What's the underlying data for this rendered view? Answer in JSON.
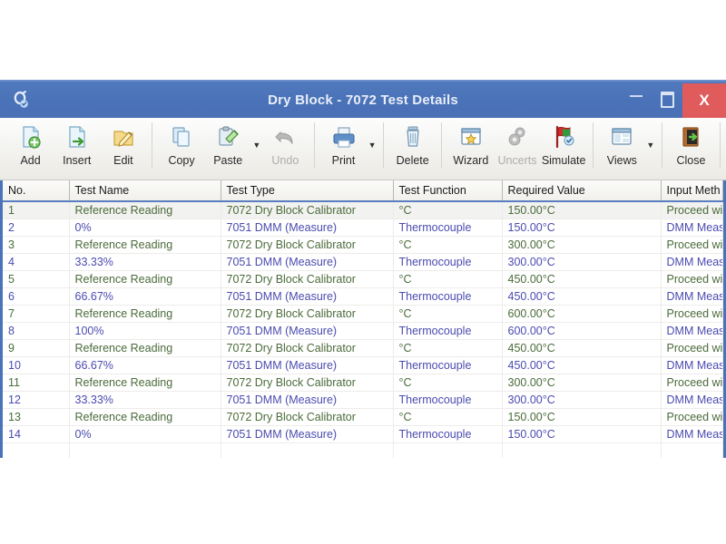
{
  "window": {
    "title": "Dry Block - 7072 Test Details",
    "app_icon": "calibration-app-icon",
    "controls": {
      "minimize": "minimize-icon",
      "maximize": "maximize-icon",
      "close": "X"
    }
  },
  "toolbar": {
    "items": [
      {
        "label": "Add",
        "icon": "add-document-icon",
        "disabled": false,
        "caret": false,
        "group_end": false
      },
      {
        "label": "Insert",
        "icon": "insert-document-icon",
        "disabled": false,
        "caret": false,
        "group_end": false
      },
      {
        "label": "Edit",
        "icon": "edit-pencil-icon",
        "disabled": false,
        "caret": false,
        "group_end": true
      },
      {
        "label": "Copy",
        "icon": "copy-pages-icon",
        "disabled": false,
        "caret": false,
        "group_end": false
      },
      {
        "label": "Paste",
        "icon": "paste-clipboard-icon",
        "disabled": false,
        "caret": true,
        "group_end": false
      },
      {
        "label": "Undo",
        "icon": "undo-arrow-icon",
        "disabled": true,
        "caret": false,
        "group_end": true
      },
      {
        "label": "Print",
        "icon": "printer-icon",
        "disabled": false,
        "caret": true,
        "group_end": true
      },
      {
        "label": "Delete",
        "icon": "trash-bin-icon",
        "disabled": false,
        "caret": false,
        "group_end": true
      },
      {
        "label": "Wizard",
        "icon": "wizard-window-icon",
        "disabled": false,
        "caret": false,
        "group_end": false
      },
      {
        "label": "Uncerts",
        "icon": "uncertainty-gears-icon",
        "disabled": true,
        "caret": false,
        "group_end": false
      },
      {
        "label": "Simulate",
        "icon": "simulate-flag-icon",
        "disabled": false,
        "caret": false,
        "group_end": true
      },
      {
        "label": "Views",
        "icon": "views-window-icon",
        "disabled": false,
        "caret": true,
        "group_end": true
      },
      {
        "label": "Close",
        "icon": "exit-door-icon",
        "disabled": false,
        "caret": false,
        "group_end": true
      }
    ]
  },
  "table": {
    "columns": [
      "No.",
      "Test Name",
      "Test Type",
      "Test Function",
      "Required Value",
      "Input Meth"
    ],
    "rows": [
      {
        "no": "1",
        "name": "Reference Reading",
        "type": "7072 Dry Block Calibrator",
        "func": "°C",
        "req": "150.00°C",
        "input": "Proceed wi",
        "color": "green"
      },
      {
        "no": "2",
        "name": "0%",
        "type": "7051 DMM (Measure)",
        "func": "Thermocouple",
        "req": "150.00°C",
        "input": "DMM Meas",
        "color": "blue"
      },
      {
        "no": "3",
        "name": "Reference Reading",
        "type": "7072 Dry Block Calibrator",
        "func": "°C",
        "req": "300.00°C",
        "input": "Proceed wi",
        "color": "green"
      },
      {
        "no": "4",
        "name": "33.33%",
        "type": "7051 DMM (Measure)",
        "func": "Thermocouple",
        "req": "300.00°C",
        "input": "DMM Meas",
        "color": "blue"
      },
      {
        "no": "5",
        "name": "Reference Reading",
        "type": "7072 Dry Block Calibrator",
        "func": "°C",
        "req": "450.00°C",
        "input": "Proceed wi",
        "color": "green"
      },
      {
        "no": "6",
        "name": "66.67%",
        "type": "7051 DMM (Measure)",
        "func": "Thermocouple",
        "req": "450.00°C",
        "input": "DMM Meas",
        "color": "blue"
      },
      {
        "no": "7",
        "name": "Reference Reading",
        "type": "7072 Dry Block Calibrator",
        "func": "°C",
        "req": "600.00°C",
        "input": "Proceed wi",
        "color": "green"
      },
      {
        "no": "8",
        "name": "100%",
        "type": "7051 DMM (Measure)",
        "func": "Thermocouple",
        "req": "600.00°C",
        "input": "DMM Meas",
        "color": "blue"
      },
      {
        "no": "9",
        "name": "Reference Reading",
        "type": "7072 Dry Block Calibrator",
        "func": "°C",
        "req": "450.00°C",
        "input": "Proceed wi",
        "color": "green"
      },
      {
        "no": "10",
        "name": "66.67%",
        "type": "7051 DMM (Measure)",
        "func": "Thermocouple",
        "req": "450.00°C",
        "input": "DMM Meas",
        "color": "blue"
      },
      {
        "no": "11",
        "name": "Reference Reading",
        "type": "7072 Dry Block Calibrator",
        "func": "°C",
        "req": "300.00°C",
        "input": "Proceed wi",
        "color": "green"
      },
      {
        "no": "12",
        "name": "33.33%",
        "type": "7051 DMM (Measure)",
        "func": "Thermocouple",
        "req": "300.00°C",
        "input": "DMM Meas",
        "color": "blue"
      },
      {
        "no": "13",
        "name": "Reference Reading",
        "type": "7072 Dry Block Calibrator",
        "func": "°C",
        "req": "150.00°C",
        "input": "Proceed wi",
        "color": "green"
      },
      {
        "no": "14",
        "name": "0%",
        "type": "7051 DMM (Measure)",
        "func": "Thermocouple",
        "req": "150.00°C",
        "input": "DMM Meas",
        "color": "blue"
      }
    ]
  },
  "colors": {
    "titlebar": "#4a72b8",
    "close_button": "#e05b5b",
    "reference_row_text": "#4b6b3a",
    "dmm_row_text": "#4b4bb0",
    "header_underline": "#5a7fc0"
  }
}
